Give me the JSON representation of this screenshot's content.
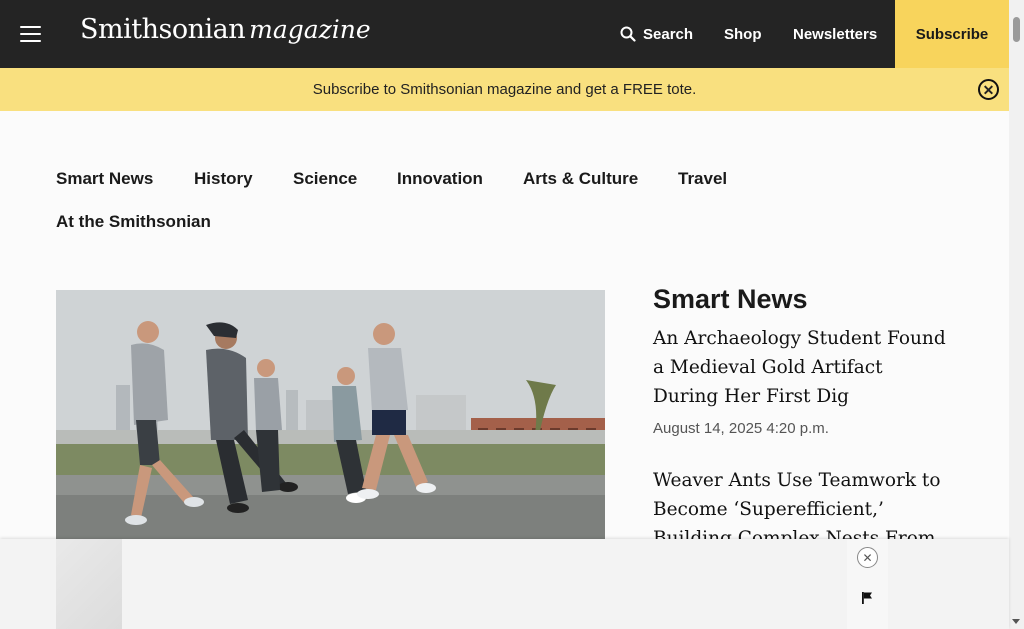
{
  "header": {
    "brand": "Smithsonian",
    "brand_suffix": "magazine",
    "search_label": "Search",
    "shop_label": "Shop",
    "newsletters_label": "Newsletters",
    "subscribe_label": "Subscribe"
  },
  "promo": {
    "text": "Subscribe to Smithsonian magazine and get a FREE tote."
  },
  "section_nav": {
    "items": [
      "Smart News",
      "History",
      "Science",
      "Innovation",
      "Arts & Culture",
      "Travel",
      "At the Smithsonian"
    ]
  },
  "sidebar": {
    "title": "Smart News",
    "articles": [
      {
        "title": "An Archaeology Student Found a Medieval Gold Artifact During Her First Dig",
        "date": "August 14, 2025 4:20 p.m."
      },
      {
        "title": "Weaver Ants Use Teamwork to Become ‘Superefficient,’ Building Complex Nests From Leaves With"
      }
    ]
  },
  "colors": {
    "header_bg": "#242424",
    "accent_yellow": "#f8d45c",
    "promo_bg": "#f9e07f"
  }
}
